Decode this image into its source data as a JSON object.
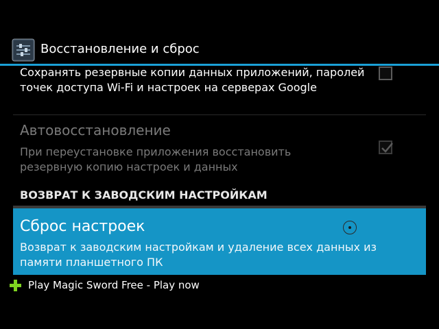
{
  "action_bar": {
    "title": "Восстановление и сброс",
    "icon": "settings-sliders-icon"
  },
  "backup": {
    "summary": "Сохранять резервные копии данных приложений, паролей точек доступа Wi-Fi и настроек на серверах Google",
    "checked": false
  },
  "auto_restore": {
    "title": "Автовосстановление",
    "summary": "При переустановке приложения восстановить резервную копию настроек и данных",
    "checked": true,
    "enabled": false
  },
  "factory_section": {
    "header": "ВОЗВРАТ К ЗАВОДСКИМ НАСТРОЙКАМ"
  },
  "factory_reset": {
    "title": "Сброс настроек",
    "summary": "Возврат к заводским настройкам и удаление всех данных из памяти планшетного ПК"
  },
  "ad": {
    "text": "Play Magic Sword Free - Play now",
    "icon": "plus-icon"
  },
  "colors": {
    "accent": "#1595c6",
    "action_bar_line": "#1aa0d6",
    "ad_plus": "#7ed321",
    "disabled_text": "#7a7a7a"
  }
}
